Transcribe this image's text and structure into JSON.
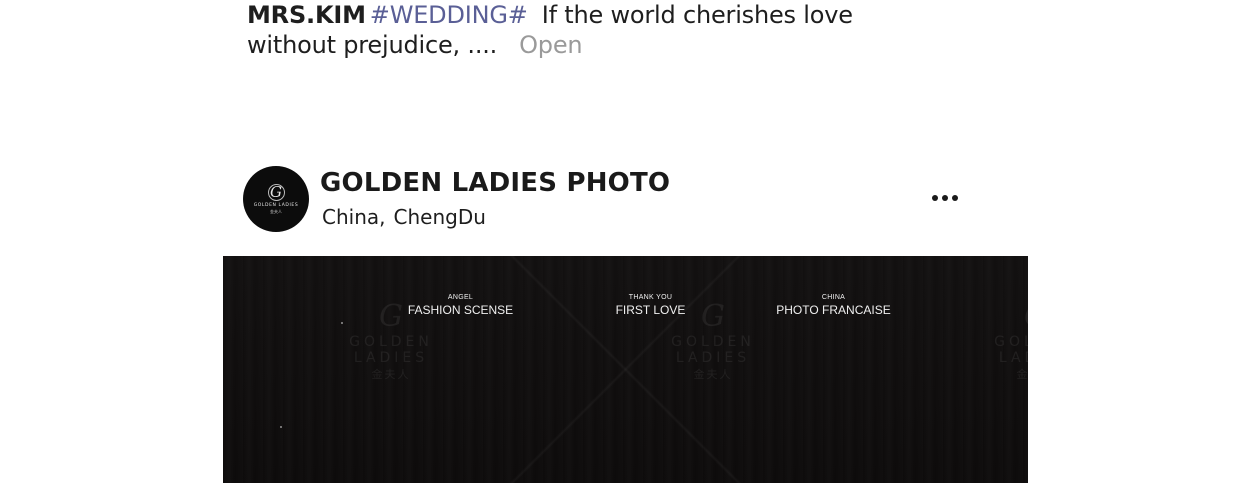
{
  "caption": {
    "username": "MRS.KIM",
    "hashtag": "#WEDDING#",
    "text": "If the world cherishes love without prejudice, ....",
    "more_label": "Open"
  },
  "post": {
    "account_name": "GOLDEN LADIES PHOTO",
    "location_country": "China,",
    "location_city": "ChengDu",
    "avatar": {
      "monogram": "G",
      "brand": "GOLDEN LADIES",
      "sub": "金夫人"
    },
    "more_icon": "more-dots-icon",
    "photo": {
      "watermark": {
        "monogram": "G",
        "brand": "GOLDEN LADIES",
        "sub": "金夫人"
      },
      "labels": [
        {
          "small": "ANGEL",
          "big": "FASHION SCENSE"
        },
        {
          "small": "THANK YOU",
          "big": "FIRST LOVE"
        },
        {
          "small": "CHINA",
          "big": "PHOTO FRANCAISE"
        }
      ]
    }
  }
}
